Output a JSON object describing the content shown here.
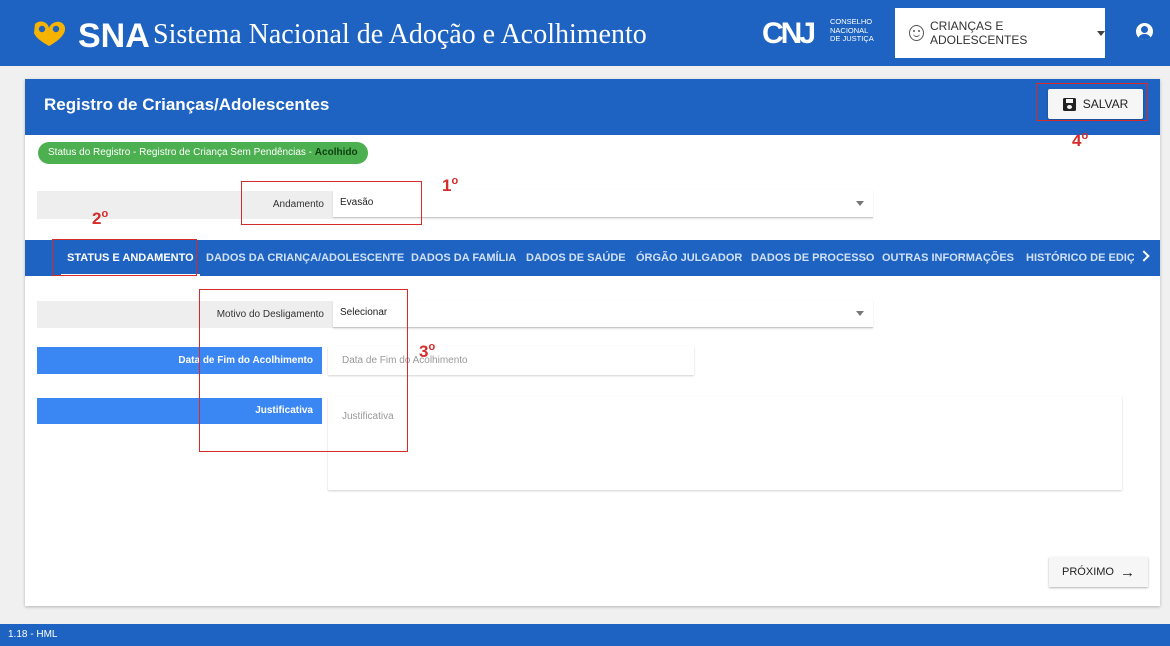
{
  "header": {
    "logo_abbr": "SNA",
    "title": "Sistema Nacional de Adoção e Acolhimento",
    "cnj_mark": "CNJ",
    "cnj_line1": "CONSELHO",
    "cnj_line2": "NACIONAL",
    "cnj_line3": "DE JUSTIÇA",
    "menu_label": "CRIANÇAS E ADOLESCENTES",
    "menu_icon": "child-face-icon",
    "user_icon": "user-icon",
    "brand_color": "#1e63c1"
  },
  "card": {
    "title": "Registro de Crianças/Adolescentes",
    "save_label": "SALVAR",
    "status_text": "Status do Registro - Registro de Criança Sem Pendências - ",
    "status_value": "Acolhido",
    "andamento": {
      "label": "Andamento",
      "value": "Evasão"
    },
    "tabs": [
      "STATUS E ANDAMENTO",
      "DADOS DA CRIANÇA/ADOLESCENTE",
      "DADOS DA FAMÍLIA",
      "DADOS DE SAÚDE",
      "ÓRGÃO JULGADOR",
      "DADOS DE PROCESSO",
      "OUTRAS INFORMAÇÕES",
      "HISTÓRICO DE EDIÇÃ"
    ],
    "motivo": {
      "label": "Motivo do Desligamento",
      "value": "Selecionar"
    },
    "data_fim": {
      "label": "Data de Fim do Acolhimento",
      "placeholder": "Data de Fim do Acolhimento"
    },
    "justificativa": {
      "label": "Justificativa",
      "placeholder": "Justificativa"
    },
    "next_label": "PRÓXIMO",
    "next_arrow": "→"
  },
  "annotations": {
    "n1": "1",
    "n2": "2",
    "n3": "3",
    "n4": "4",
    "ordinal": "o"
  },
  "footer": {
    "version": "1.18 - HML"
  }
}
